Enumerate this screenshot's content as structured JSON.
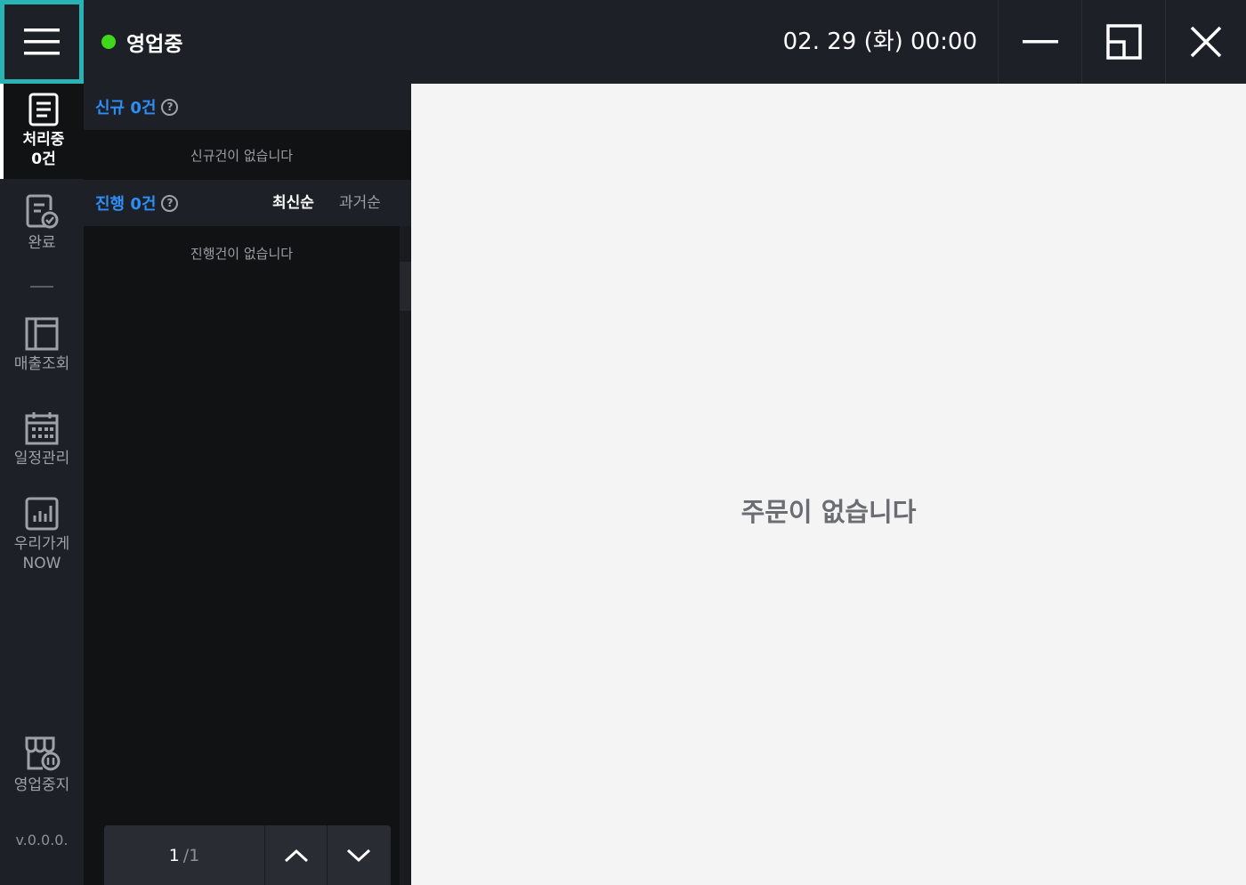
{
  "header": {
    "status_label": "영업중",
    "status_color": "#3fd81a",
    "datetime": "02. 29 (화) 00:00",
    "menu_icon": "hamburger-icon",
    "accent_color": "#2ab3b5"
  },
  "nav": {
    "items": [
      {
        "label": "처리중",
        "sub": "0건",
        "icon": "document-list-icon"
      },
      {
        "label": "완료",
        "icon": "document-check-icon"
      },
      {
        "label": "매출조회",
        "icon": "ledger-icon"
      },
      {
        "label": "일정관리",
        "icon": "calendar-icon"
      },
      {
        "label": "우리가게",
        "sub": "NOW",
        "icon": "bar-chart-icon"
      },
      {
        "label": "영업중지",
        "icon": "store-pause-icon"
      }
    ],
    "version": "v.0.0.0."
  },
  "orders": {
    "new_title": "신규 0건",
    "new_empty": "신규건이 없습니다",
    "progress_title": "진행 0건",
    "progress_empty": "진행건이 없습니다",
    "sort_latest": "최신순",
    "sort_oldest": "과거순",
    "help_glyph": "?"
  },
  "pager": {
    "current": "1",
    "total": "/1"
  },
  "main": {
    "empty_text": "주문이 없습니다"
  }
}
